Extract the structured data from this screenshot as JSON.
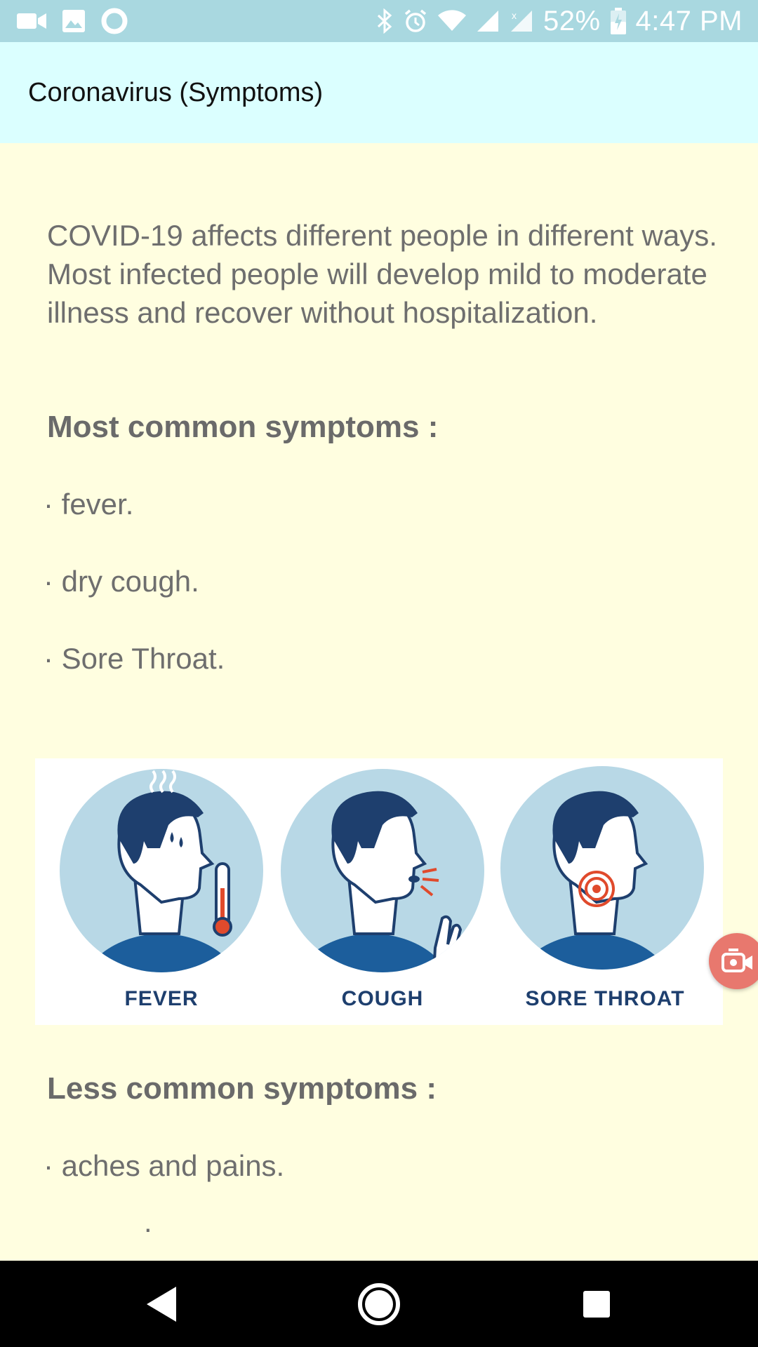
{
  "status_bar": {
    "battery": "52%",
    "time": "4:47 PM",
    "icons": [
      "video-camera-icon",
      "image-icon",
      "circle-icon",
      "bluetooth-icon",
      "alarm-icon",
      "wifi-icon",
      "signal-icon",
      "signal-no-data-icon",
      "battery-charging-icon"
    ]
  },
  "app_bar": {
    "title": "Coronavirus (Symptoms)"
  },
  "content": {
    "intro": "COVID-19 affects different people in different ways. Most infected people will develop mild to moderate illness and recover without hospitalization.",
    "most_common_heading": "Most common symptoms :",
    "most_common": [
      "· fever.",
      "· dry cough.",
      "· Sore Throat."
    ],
    "image_labels": [
      "FEVER",
      "COUGH",
      "SORE THROAT"
    ],
    "less_common_heading": "Less common symptoms :",
    "less_common": [
      "· aches and pains.",
      "."
    ]
  },
  "floating_button": {
    "icon": "video-call-icon",
    "color": "#E8786E"
  },
  "nav_bar": {
    "icons": [
      "back-icon",
      "home-icon",
      "recents-icon"
    ]
  },
  "colors": {
    "status_bar": "#A9D8E0",
    "app_bar": "#DBFFFF",
    "background": "#FFFEE0",
    "illustration_circle": "#B8D8E6",
    "illustration_dark": "#1E3F6E",
    "illustration_shirt": "#1C5E9C",
    "illustration_red": "#E04A2C"
  }
}
